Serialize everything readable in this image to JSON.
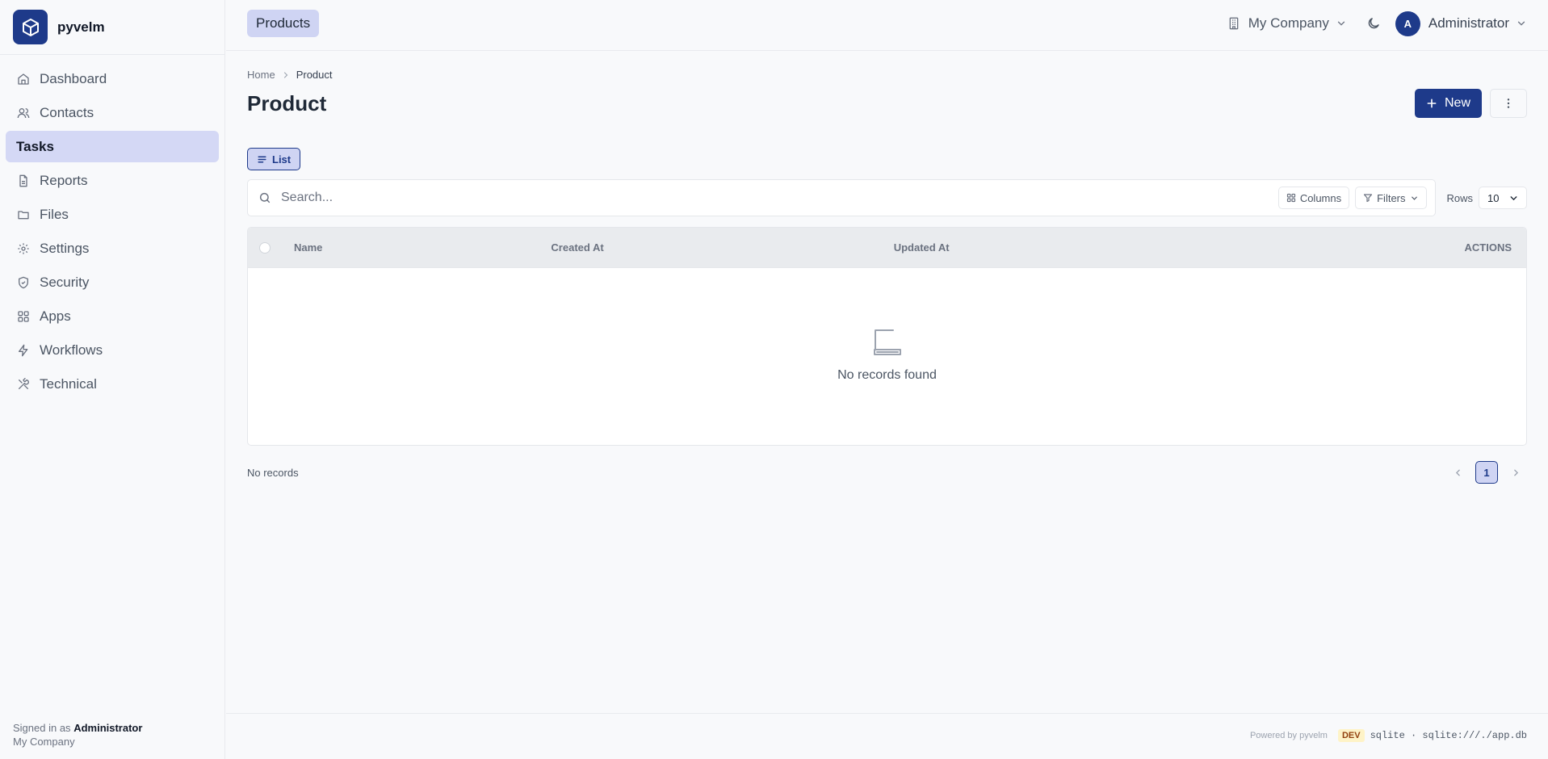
{
  "brand": {
    "name": "pyvelm",
    "logo_icon": "cube-icon"
  },
  "sidebar": {
    "items": [
      {
        "label": "Dashboard",
        "icon": "home-icon"
      },
      {
        "label": "Contacts",
        "icon": "users-icon"
      },
      {
        "label": "Tasks",
        "icon": "",
        "active": true
      },
      {
        "label": "Reports",
        "icon": "file-icon"
      },
      {
        "label": "Files",
        "icon": "folder-icon"
      },
      {
        "label": "Settings",
        "icon": "gear-icon"
      },
      {
        "label": "Security",
        "icon": "shield-icon"
      },
      {
        "label": "Apps",
        "icon": "grid-icon"
      },
      {
        "label": "Workflows",
        "icon": "bolt-icon"
      },
      {
        "label": "Technical",
        "icon": "tools-icon"
      }
    ],
    "footer": {
      "prefix": "Signed in as",
      "user": "Administrator",
      "company": "My Company"
    }
  },
  "topbar": {
    "module_label": "Products",
    "company": "My Company",
    "user_initial": "A",
    "user_name": "Administrator"
  },
  "breadcrumb": {
    "home": "Home",
    "current": "Product"
  },
  "page": {
    "title": "Product",
    "new_label": "New"
  },
  "view": {
    "list_label": "List"
  },
  "search": {
    "placeholder": "Search...",
    "value": ""
  },
  "toolbar": {
    "columns_label": "Columns",
    "filters_label": "Filters",
    "rows_label": "Rows",
    "rows_value": "10"
  },
  "table": {
    "columns": [
      "Name",
      "Created At",
      "Updated At",
      "ACTIONS"
    ],
    "rows": [],
    "empty_text": "No records found"
  },
  "pagination": {
    "info": "No records",
    "current_page": "1"
  },
  "footer": {
    "powered": "Powered by pyvelm",
    "env": "DEV",
    "db": "sqlite · sqlite:///./app.db"
  },
  "colors": {
    "accent": "#1e3a8a",
    "accent_light": "#cfd4f3",
    "background": "#f8f9fb"
  }
}
